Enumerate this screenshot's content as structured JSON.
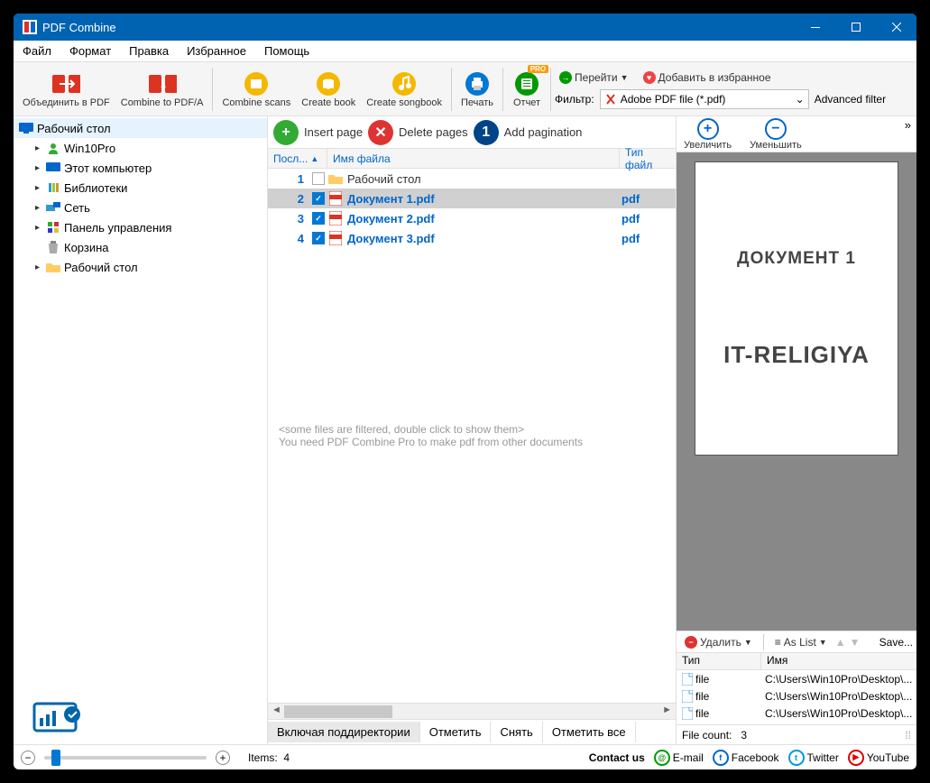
{
  "title": "PDF Combine",
  "menu": [
    "Файл",
    "Формат",
    "Правка",
    "Избранное",
    "Помощь"
  ],
  "toolbar": {
    "combine_pdf": "Объединить в PDF",
    "combine_pdfa": "Combine to PDF/A",
    "combine_scans": "Combine scans",
    "create_book": "Create book",
    "create_songbook": "Create songbook",
    "print": "Печать",
    "report": "Отчет",
    "pro_badge": "PRO",
    "go": "Перейти",
    "favorite": "Добавить в избранное",
    "filter_label": "Фильтр:",
    "filter_value": "Adobe PDF file (*.pdf)",
    "advanced_filter": "Advanced filter"
  },
  "tree": {
    "root": "Рабочий стол",
    "items": [
      {
        "label": "Win10Pro"
      },
      {
        "label": "Этот компьютер"
      },
      {
        "label": "Библиотеки"
      },
      {
        "label": "Сеть"
      },
      {
        "label": "Панель управления"
      },
      {
        "label": "Корзина"
      },
      {
        "label": "Рабочий стол"
      }
    ]
  },
  "centerbar": {
    "insert": "Insert page",
    "delete": "Delete pages",
    "paginate": "Add pagination"
  },
  "cols": {
    "seq": "Посл...",
    "name": "Имя файла",
    "type": "Тип файл"
  },
  "files": [
    {
      "n": "1",
      "checked": false,
      "name": "Рабочий стол",
      "type": "",
      "folder": true
    },
    {
      "n": "2",
      "checked": true,
      "name": "Документ 1.pdf",
      "type": "pdf",
      "sel": true
    },
    {
      "n": "3",
      "checked": true,
      "name": "Документ 2.pdf",
      "type": "pdf"
    },
    {
      "n": "4",
      "checked": true,
      "name": "Документ 3.pdf",
      "type": "pdf"
    }
  ],
  "hints": {
    "l1": "<some files are filtered, double click to show them>",
    "l2": "You need PDF Combine Pro to make pdf from other documents"
  },
  "centerbtns": {
    "subdirs": "Включая поддиректории",
    "mark": "Отметить",
    "unmark": "Снять",
    "markall": "Отметить все"
  },
  "zoom": {
    "in": "Увеличить",
    "out": "Уменьшить"
  },
  "preview": {
    "t1": "ДОКУМЕНТ 1",
    "t2": "IT-RELIGIYA"
  },
  "queue": {
    "delete": "Удалить",
    "aslist": "As List",
    "save": "Save...",
    "cols": {
      "type": "Тип",
      "name": "Имя"
    },
    "rows": [
      {
        "type": "file",
        "name": "C:\\Users\\Win10Pro\\Desktop\\..."
      },
      {
        "type": "file",
        "name": "C:\\Users\\Win10Pro\\Desktop\\..."
      },
      {
        "type": "file",
        "name": "C:\\Users\\Win10Pro\\Desktop\\..."
      }
    ],
    "count_label": "File count:",
    "count": "3"
  },
  "status": {
    "items_label": "Items:",
    "items": "4",
    "contact": "Contact us",
    "email": "E-mail",
    "facebook": "Facebook",
    "twitter": "Twitter",
    "youtube": "YouTube"
  }
}
